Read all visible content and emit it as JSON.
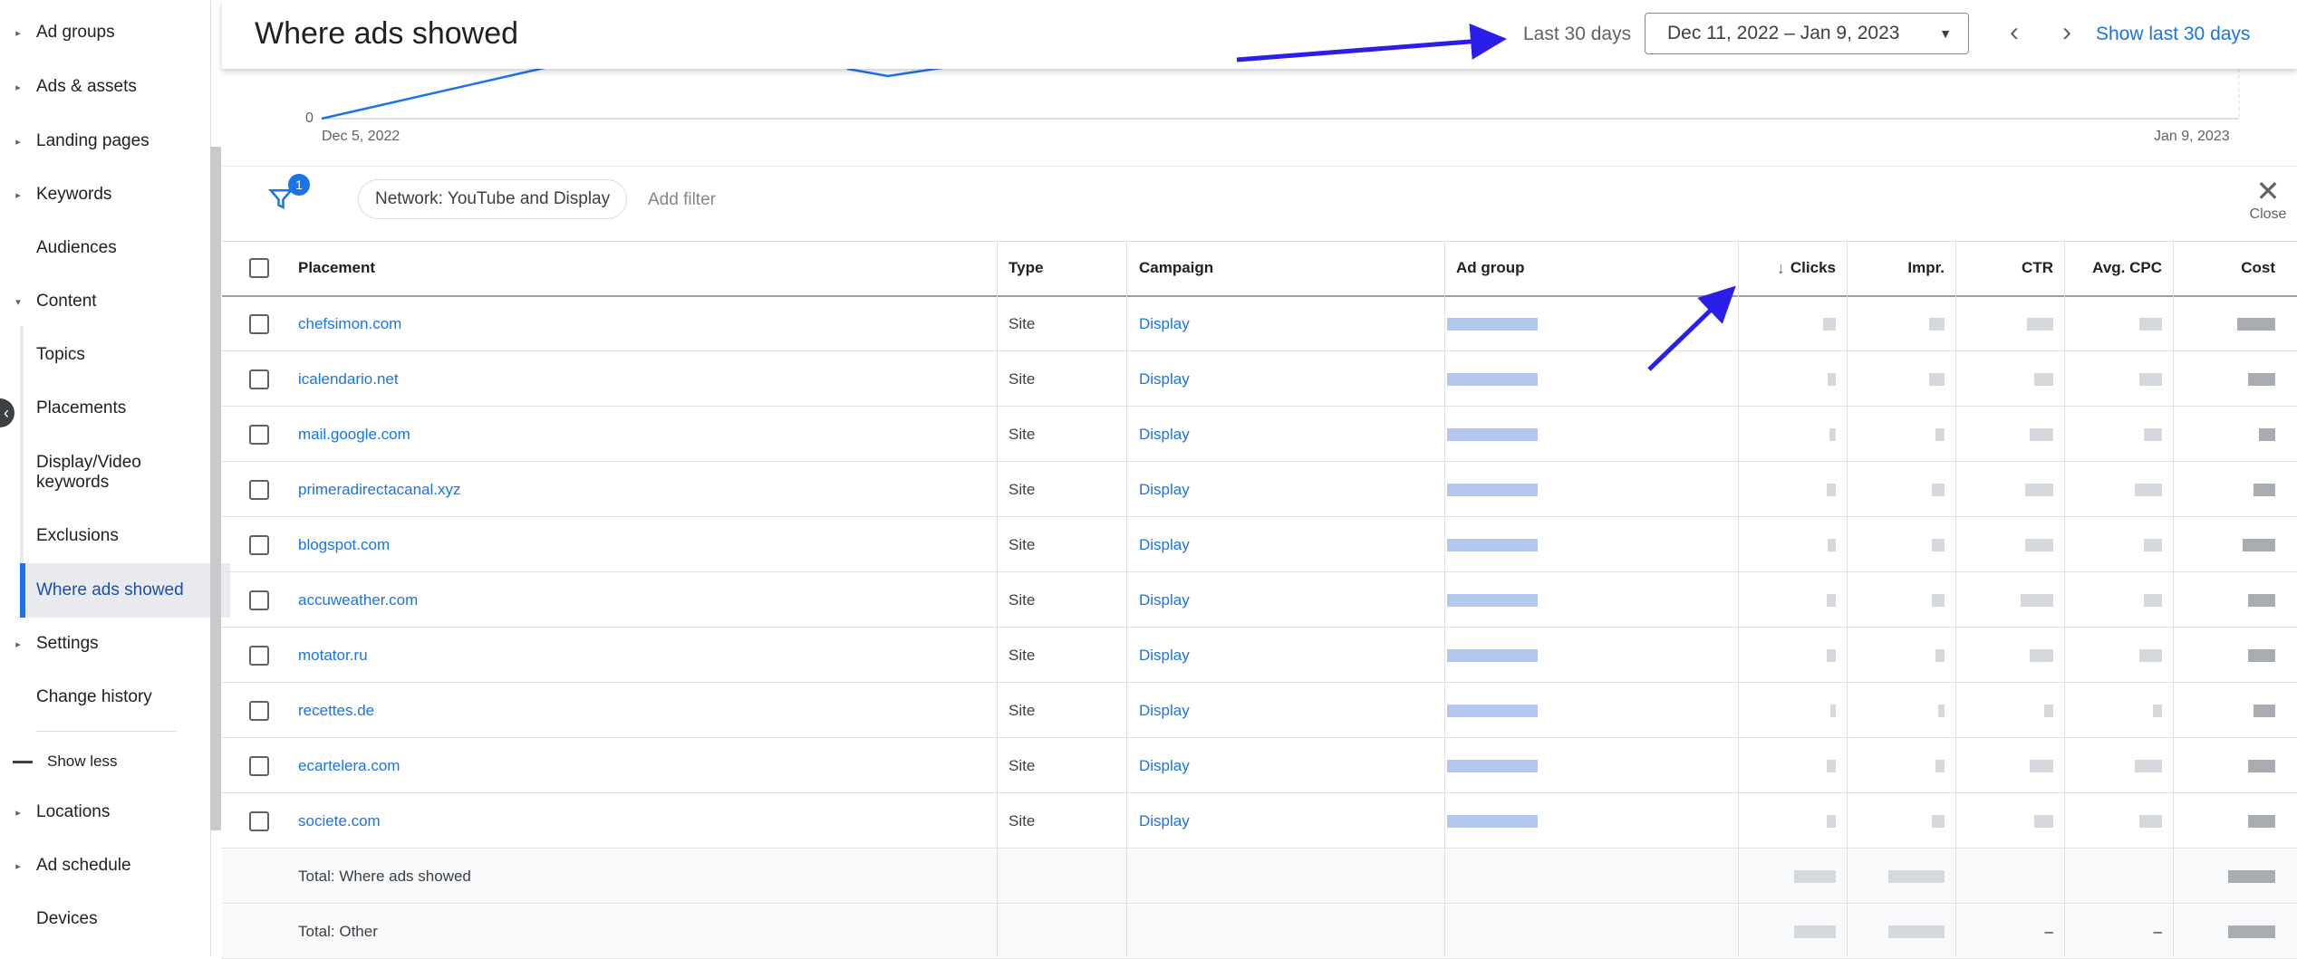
{
  "sidebar": {
    "items": [
      {
        "label": "Ad groups",
        "caret": "right"
      },
      {
        "label": "Ads & assets",
        "caret": "right"
      },
      {
        "label": "Landing pages",
        "caret": "right"
      },
      {
        "label": "Keywords",
        "caret": "right"
      },
      {
        "label": "Audiences",
        "caret": ""
      },
      {
        "label": "Content",
        "caret": "down"
      },
      {
        "label": "Topics",
        "sub": true
      },
      {
        "label": "Placements",
        "sub": true
      },
      {
        "label": "Display/Video keywords",
        "sub": true
      },
      {
        "label": "Exclusions",
        "sub": true
      },
      {
        "label": "Where ads showed",
        "sub": true,
        "active": true
      },
      {
        "label": "Settings",
        "caret": "right"
      },
      {
        "label": "Change history",
        "caret": ""
      }
    ],
    "show_less": "Show less",
    "bottom_items": [
      {
        "label": "Locations",
        "caret": "right"
      },
      {
        "label": "Ad schedule",
        "caret": "right"
      },
      {
        "label": "Devices",
        "caret": ""
      }
    ]
  },
  "header": {
    "title": "Where ads showed",
    "date_preset": "Last 30 days",
    "date_range": "Dec 11, 2022 – Jan 9, 2023",
    "show_last": "Show last 30 days"
  },
  "chart": {
    "y_zero": "0",
    "x_start": "Dec 5, 2022",
    "x_end": "Jan 9, 2023"
  },
  "filter": {
    "badge": "1",
    "chip": "Network: YouTube and Display",
    "add_filter": "Add filter",
    "close": "Close"
  },
  "table": {
    "columns": {
      "placement": "Placement",
      "type": "Type",
      "campaign": "Campaign",
      "ad_group": "Ad group",
      "clicks": "Clicks",
      "impr": "Impr.",
      "ctr": "CTR",
      "avg_cpc": "Avg. CPC",
      "cost": "Cost"
    },
    "rows": [
      {
        "placement": "chefsimon.com",
        "type": "Site",
        "campaign": "Display"
      },
      {
        "placement": "icalendario.net",
        "type": "Site",
        "campaign": "Display"
      },
      {
        "placement": "mail.google.com",
        "type": "Site",
        "campaign": "Display"
      },
      {
        "placement": "primeradirectacanal.xyz",
        "type": "Site",
        "campaign": "Display"
      },
      {
        "placement": "blogspot.com",
        "type": "Site",
        "campaign": "Display"
      },
      {
        "placement": "accuweather.com",
        "type": "Site",
        "campaign": "Display"
      },
      {
        "placement": "motator.ru",
        "type": "Site",
        "campaign": "Display"
      },
      {
        "placement": "recettes.de",
        "type": "Site",
        "campaign": "Display"
      },
      {
        "placement": "ecartelera.com",
        "type": "Site",
        "campaign": "Display"
      },
      {
        "placement": "societe.com",
        "type": "Site",
        "campaign": "Display"
      }
    ],
    "totals": [
      {
        "label": "Total: Where ads showed",
        "ctr": "",
        "avg_cpc": ""
      },
      {
        "label": "Total: Other",
        "ctr": "–",
        "avg_cpc": "–"
      }
    ]
  },
  "colors": {
    "accent": "#1a73e8",
    "annotation_arrow": "#2b1ee8"
  }
}
